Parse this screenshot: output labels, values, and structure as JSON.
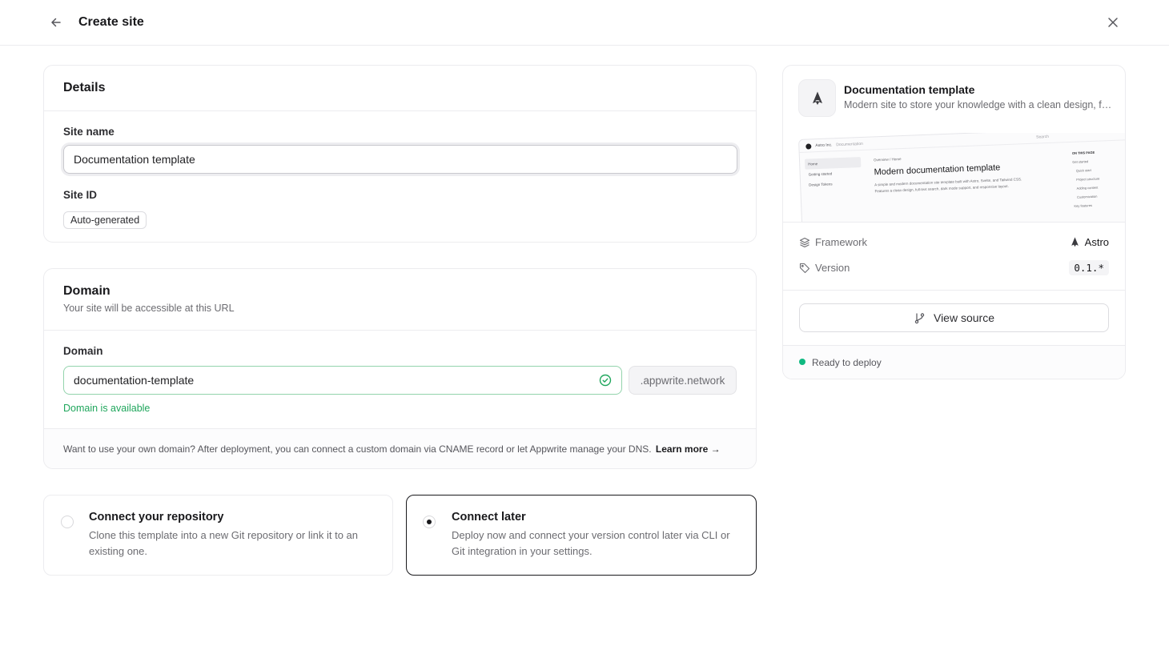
{
  "header": {
    "title": "Create site"
  },
  "details": {
    "title": "Details",
    "site_name_label": "Site name",
    "site_name_value": "Documentation template",
    "site_id_label": "Site ID",
    "site_id_value": "Auto-generated"
  },
  "domain": {
    "title": "Domain",
    "subtitle": "Your site will be accessible at this URL",
    "field_label": "Domain",
    "value": "documentation-template",
    "suffix": ".appwrite.network",
    "status": "Domain is available",
    "note": "Want to use your own domain? After deployment, you can connect a custom domain via CNAME record or let Appwrite manage your DNS.",
    "learn_more": "Learn more →"
  },
  "connect": {
    "repo": {
      "title": "Connect your repository",
      "desc": "Clone this template into a new Git repository or link it to an existing one.",
      "selected": false
    },
    "later": {
      "title": "Connect later",
      "desc": "Deploy now and connect your version control later via CLI or Git integration in your settings.",
      "selected": true
    }
  },
  "template": {
    "name": "Documentation template",
    "desc": "Modern site to store your knowledge with a clean design, full...",
    "preview": {
      "brand": "Astro Inc.",
      "crumb_tag": "Documentation",
      "search": "Search",
      "nav": [
        "Home",
        "Getting started",
        "Design Tokens"
      ],
      "breadcrumb": "Overview / Home",
      "heading": "Modern documentation template",
      "body1": "A simple and modern documentation site template built with Astro, Svelte, and Tailwind CSS.",
      "body2": "Features a clean design, full-text search, dark mode support, and responsive layout.",
      "toc_title": "ON THIS PAGE",
      "toc": [
        "Get started",
        "Quick start",
        "Project structure",
        "Adding content",
        "Customization",
        "Key features"
      ]
    },
    "framework_label": "Framework",
    "framework_value": "Astro",
    "version_label": "Version",
    "version_value": "0.1.*",
    "view_source": "View source",
    "status": "Ready to deploy"
  },
  "colors": {
    "accent_green": "#1fa65c",
    "status_dot": "#10b981",
    "primary": "#19191c"
  }
}
